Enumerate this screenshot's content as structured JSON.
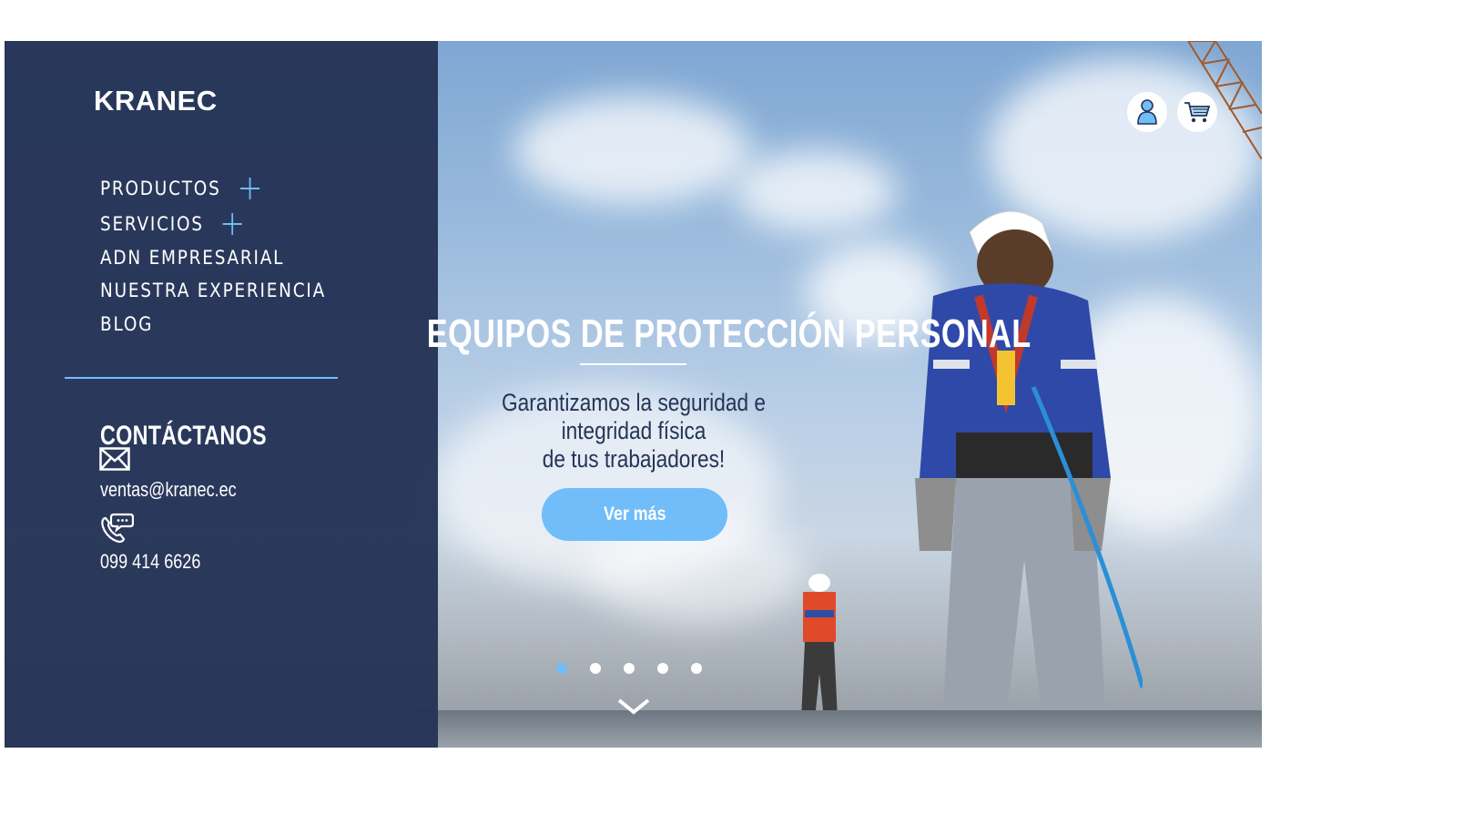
{
  "brand": {
    "logo_text": "KRANEC"
  },
  "nav": {
    "items": [
      {
        "label": "PRODUCTOS",
        "expandable": true
      },
      {
        "label": "SERVICIOS",
        "expandable": true
      },
      {
        "label": "ADN EMPRESARIAL",
        "expandable": false
      },
      {
        "label": "NUESTRA EXPERIENCIA",
        "expandable": false
      },
      {
        "label": "BLOG",
        "expandable": false
      }
    ]
  },
  "contact": {
    "heading": "CONTÁCTANOS",
    "email": "ventas@kranec.ec",
    "phone": "099 414 6626",
    "icons": [
      "envelope-icon",
      "phone-chat-icon"
    ]
  },
  "hero": {
    "title": "EQUIPOS DE PROTECCIÓN PERSONAL",
    "subtitle_line1": "Garantizamos la seguridad e integridad física",
    "subtitle_line2": "de tus trabajadores!",
    "cta_label": "Ver más",
    "slides": {
      "count": 5,
      "active": 1
    }
  },
  "header_icons": [
    "user-icon",
    "cart-icon"
  ],
  "colors": {
    "sidebar_bg": "#253456",
    "accent": "#71bdf9",
    "white": "#ffffff"
  }
}
